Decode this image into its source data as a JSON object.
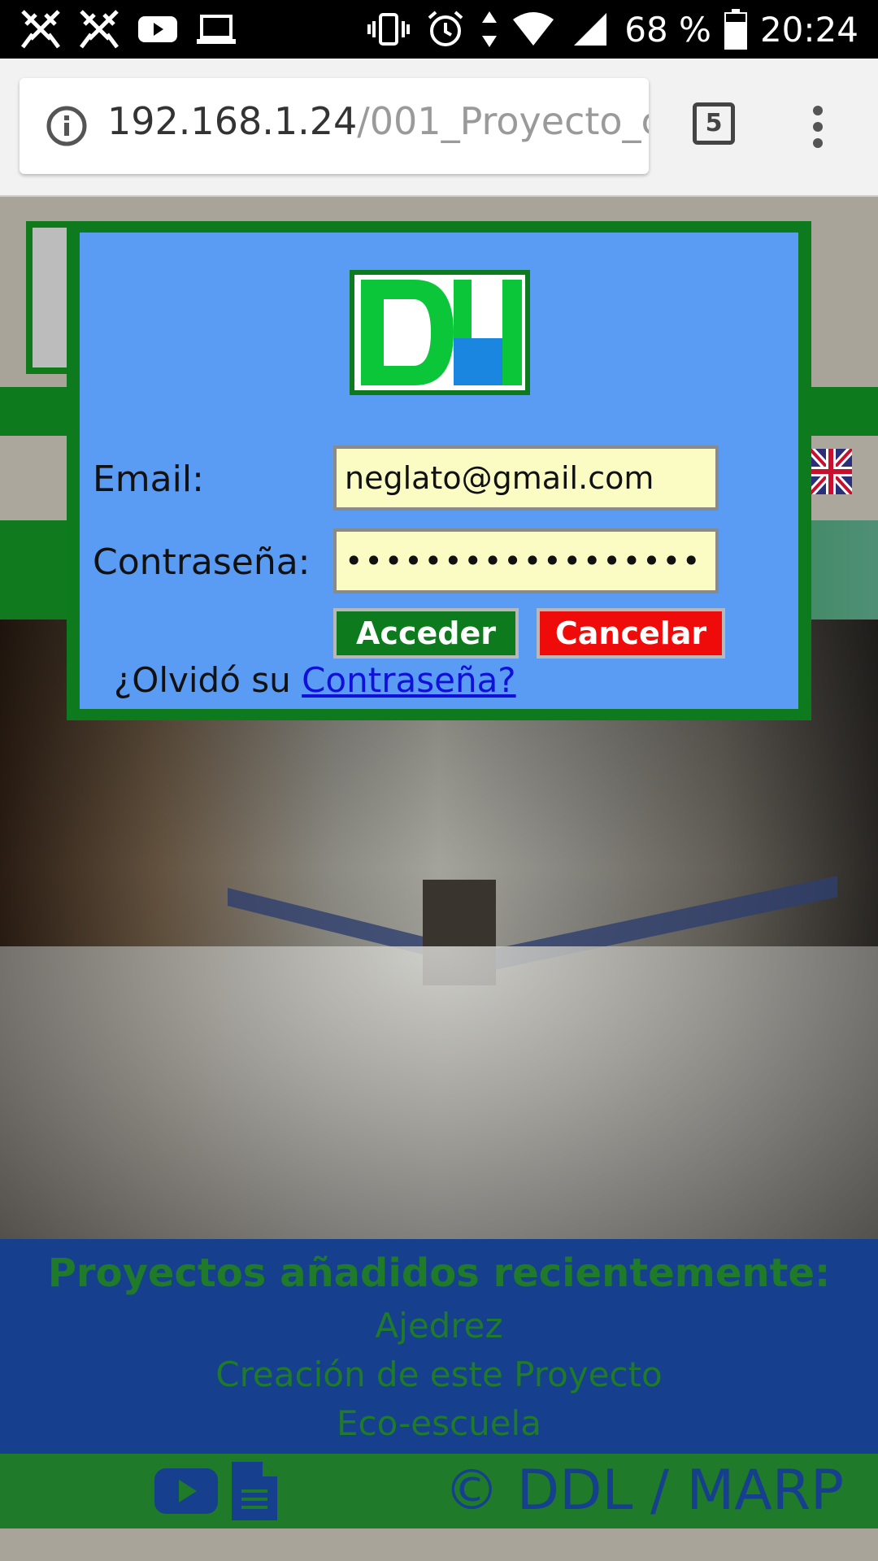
{
  "status_bar": {
    "battery_percent": "68 %",
    "time": "20:24",
    "icons": [
      "swords-icon",
      "swords-icon",
      "youtube-icon",
      "laptop-icon",
      "vibrate-icon",
      "alarm-icon",
      "data-arrows-icon",
      "wifi-icon",
      "signal-icon",
      "battery-icon"
    ]
  },
  "browser": {
    "url_host": "192.168.1.24",
    "url_path": "/001_Proyecto_c",
    "tab_count": "5"
  },
  "login_dialog": {
    "email_label": "Email:",
    "email_value": "neglato@gmail.com",
    "password_label": "Contraseña:",
    "password_value": "••••••••••••••••••",
    "login_button": "Acceder",
    "cancel_button": "Cancelar",
    "forgot_prefix": "¿Olvidó su ",
    "forgot_link": "Contraseña?"
  },
  "recent_projects": {
    "title": "Proyectos añadidos recientemente:",
    "items": [
      "Ajedrez",
      "Creación de este Proyecto",
      "Eco-escuela"
    ]
  },
  "footer": {
    "copyright": "© DDL / MARP"
  },
  "colors": {
    "dialog_border": "#0d7a1d",
    "dialog_background": "#5a9cf4",
    "field_background": "#fafcc4",
    "accept_button": "#0d7a1d",
    "cancel_button": "#f00b0b",
    "link": "#1010d8",
    "recent_background": "#163f8e",
    "recent_text": "#1f7a2a"
  }
}
